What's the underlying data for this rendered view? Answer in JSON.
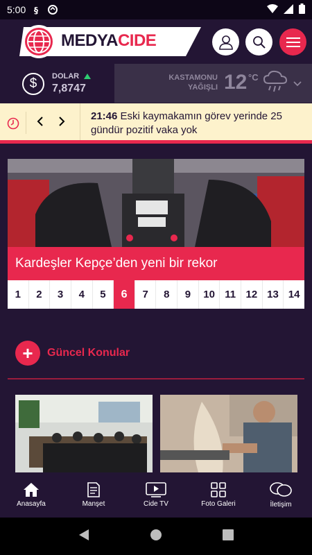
{
  "status": {
    "time": "5:00"
  },
  "header": {
    "brand_prefix": "MEDYA",
    "brand_suffix": "CIDE"
  },
  "currency": {
    "label": "DOLAR",
    "value": "7,8747",
    "trend_color": "#2ecc71"
  },
  "weather": {
    "city": "KASTAMONU",
    "condition": "YAĞIŞLI",
    "temp": "12",
    "unit": "°C"
  },
  "ticker": {
    "time": "21:46",
    "text": " Eski kaymakamın görev yerinde 25 gündür pozitif vaka yok"
  },
  "slider": {
    "caption": "Kardeşler Kepçe’den yeni bir rekor",
    "pages": [
      "1",
      "2",
      "3",
      "4",
      "5",
      "6",
      "7",
      "8",
      "9",
      "10",
      "11",
      "12",
      "13",
      "14"
    ],
    "active_page": "6"
  },
  "section": {
    "title": "Güncel Konular"
  },
  "nav": [
    {
      "label": "Anasayfa",
      "icon": "home-icon"
    },
    {
      "label": "Manşet",
      "icon": "document-icon"
    },
    {
      "label": "Cide TV",
      "icon": "tv-icon"
    },
    {
      "label": "Foto Galeri",
      "icon": "gallery-icon"
    },
    {
      "label": "İletişim",
      "icon": "chat-icon"
    }
  ],
  "colors": {
    "accent": "#e8284e",
    "background": "#231534",
    "ticker_bg": "#fdf2cc"
  }
}
